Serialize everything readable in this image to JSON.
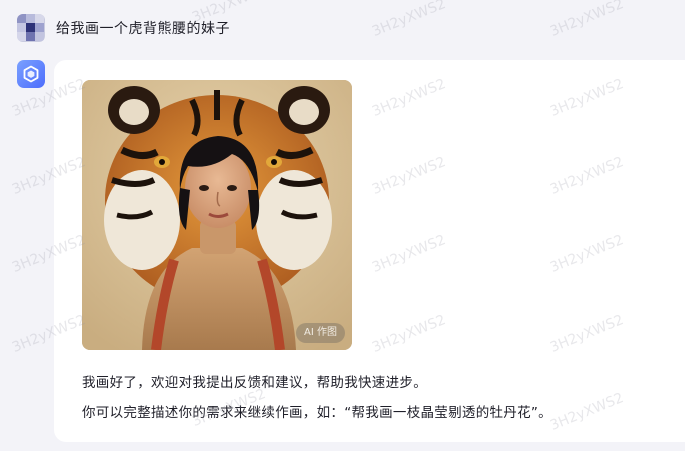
{
  "user_message": {
    "text": "给我画一个虎背熊腰的妹子"
  },
  "bot_reply": {
    "image_badge": "AI 作图",
    "line1": "我画好了，欢迎对我提出反馈和建议，帮助我快速进步。",
    "line2": "你可以完整描述你的需求来继续作画，如：“帮我画一枝晶莹剔透的牡丹花”。"
  },
  "watermark_text": "3H2yXWS2",
  "colors": {
    "page_bg": "#f3f3f8",
    "card_bg": "#ffffff",
    "bot_accent": "#4d6dfc",
    "text": "#1f1f29"
  }
}
